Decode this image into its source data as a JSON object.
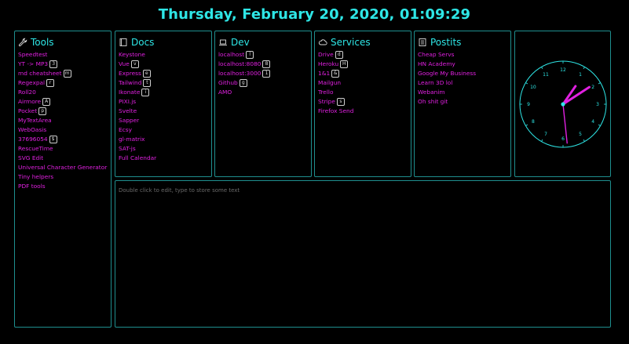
{
  "header": {
    "datetime": "Thursday, February 20, 2020, 01:09:29"
  },
  "colors": {
    "accent": "#2ee6e6",
    "link": "#e020e0",
    "border": "#1f8f8f",
    "background": "#000000"
  },
  "panels": {
    "tools": {
      "title": "Tools",
      "icon": "wrench-icon",
      "items": [
        {
          "label": "Speedtest",
          "key": ""
        },
        {
          "label": "YT -> MP3",
          "key": "3"
        },
        {
          "label": "md cheatsheet",
          "key": "m"
        },
        {
          "label": "Regexpal",
          "key": "r"
        },
        {
          "label": "Roll20",
          "key": ""
        },
        {
          "label": "Airmore",
          "key": "A"
        },
        {
          "label": "Pocket",
          "key": "p"
        },
        {
          "label": "MyTextArea",
          "key": ""
        },
        {
          "label": "WebOasis",
          "key": ""
        },
        {
          "label": "37696054",
          "key": "$"
        },
        {
          "label": "RescueTime",
          "key": ""
        },
        {
          "label": "SVG Edit",
          "key": ""
        },
        {
          "label": "Universal Character Generator",
          "key": ""
        },
        {
          "label": "Tiny helpers",
          "key": ""
        },
        {
          "label": "PDF tools",
          "key": ""
        }
      ]
    },
    "docs": {
      "title": "Docs",
      "icon": "book-icon",
      "items": [
        {
          "label": "Keystone",
          "key": ""
        },
        {
          "label": "Vue",
          "key": "v"
        },
        {
          "label": "Express",
          "key": "e"
        },
        {
          "label": "Tailwind",
          "key": "t"
        },
        {
          "label": "Ikonate",
          "key": "i"
        },
        {
          "label": "PIXI.js",
          "key": ""
        },
        {
          "label": "Svelte",
          "key": ""
        },
        {
          "label": "Sapper",
          "key": ""
        },
        {
          "label": "Ecsy",
          "key": ""
        },
        {
          "label": "gl-matrix",
          "key": ""
        },
        {
          "label": "SAT-js",
          "key": ""
        },
        {
          "label": "Full Calendar",
          "key": ""
        }
      ]
    },
    "dev": {
      "title": "Dev",
      "icon": "laptop-icon",
      "items": [
        {
          "label": "localhost",
          "key": "l"
        },
        {
          "label": "localhost:8080",
          "key": "8"
        },
        {
          "label": "localhost:3000",
          "key": "1"
        },
        {
          "label": "Github",
          "key": "g"
        },
        {
          "label": "AMO",
          "key": ""
        }
      ]
    },
    "services": {
      "title": "Services",
      "icon": "cloud-icon",
      "items": [
        {
          "label": "Drive",
          "key": "d"
        },
        {
          "label": "Heroku",
          "key": "H"
        },
        {
          "label": "1&1",
          "key": "&"
        },
        {
          "label": "Mailgun",
          "key": ""
        },
        {
          "label": "Trello",
          "key": ""
        },
        {
          "label": "Stripe",
          "key": "s"
        },
        {
          "label": "Firefox Send",
          "key": ""
        }
      ]
    },
    "postits": {
      "title": "Postits",
      "icon": "notepad-icon",
      "items": [
        {
          "label": "Cheap Servs",
          "key": ""
        },
        {
          "label": "HN Academy",
          "key": ""
        },
        {
          "label": "Google My Business",
          "key": ""
        },
        {
          "label": "Learn 3D lol",
          "key": ""
        },
        {
          "label": "Webanim",
          "key": ""
        },
        {
          "label": "Oh shit git",
          "key": ""
        }
      ]
    }
  },
  "clock": {
    "numbers": [
      "12",
      "1",
      "2",
      "3",
      "4",
      "5",
      "6",
      "7",
      "8",
      "9",
      "10",
      "11"
    ],
    "time": {
      "hours": 1,
      "minutes": 9,
      "seconds": 29
    }
  },
  "notes": {
    "placeholder": "Double click to edit, type to store some text"
  }
}
